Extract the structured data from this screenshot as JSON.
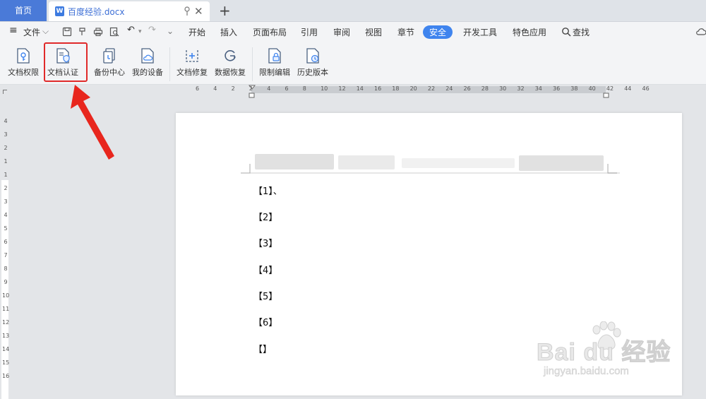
{
  "tabs": {
    "home": "首页",
    "document": "百度经验.docx",
    "new_tab": "+"
  },
  "menu": {
    "file": "文件",
    "items": [
      "开始",
      "插入",
      "页面布局",
      "引用",
      "审阅",
      "视图",
      "章节",
      "安全",
      "开发工具",
      "特色应用"
    ],
    "active": "安全",
    "search": "查找"
  },
  "toolbar": {
    "buttons": [
      {
        "id": "doc-permission",
        "label": "文档权限"
      },
      {
        "id": "doc-certify",
        "label": "文档认证"
      },
      {
        "id": "backup-center",
        "label": "备份中心"
      },
      {
        "id": "my-devices",
        "label": "我的设备"
      },
      {
        "id": "doc-repair",
        "label": "文档修复"
      },
      {
        "id": "data-recovery",
        "label": "数据恢复"
      },
      {
        "id": "restrict-edit",
        "label": "限制编辑"
      },
      {
        "id": "history-version",
        "label": "历史版本"
      }
    ],
    "highlight_color": "#e02a2a"
  },
  "ruler": {
    "h_ticks": [
      "6",
      "4",
      "2",
      "2",
      "4",
      "6",
      "8",
      "10",
      "12",
      "14",
      "16",
      "18",
      "20",
      "22",
      "24",
      "26",
      "28",
      "30",
      "32",
      "34",
      "36",
      "38",
      "40",
      "42",
      "44",
      "46"
    ],
    "v_ticks": [
      "4",
      "3",
      "2",
      "1",
      "1",
      "2",
      "3",
      "4",
      "5",
      "6",
      "7",
      "8",
      "9",
      "10",
      "11",
      "12",
      "13",
      "14",
      "15",
      "16"
    ]
  },
  "document": {
    "lines": [
      "【1】、",
      "【2】",
      "【3】",
      "【4】",
      "【5】",
      "【6】",
      "【】"
    ]
  },
  "watermark": {
    "brand": "Bai du 经验",
    "url": "jingyan.baidu.com"
  },
  "colors": {
    "accent": "#3f84ee",
    "home_tab": "#4a7ad8",
    "annotation": "#e02a2a"
  }
}
